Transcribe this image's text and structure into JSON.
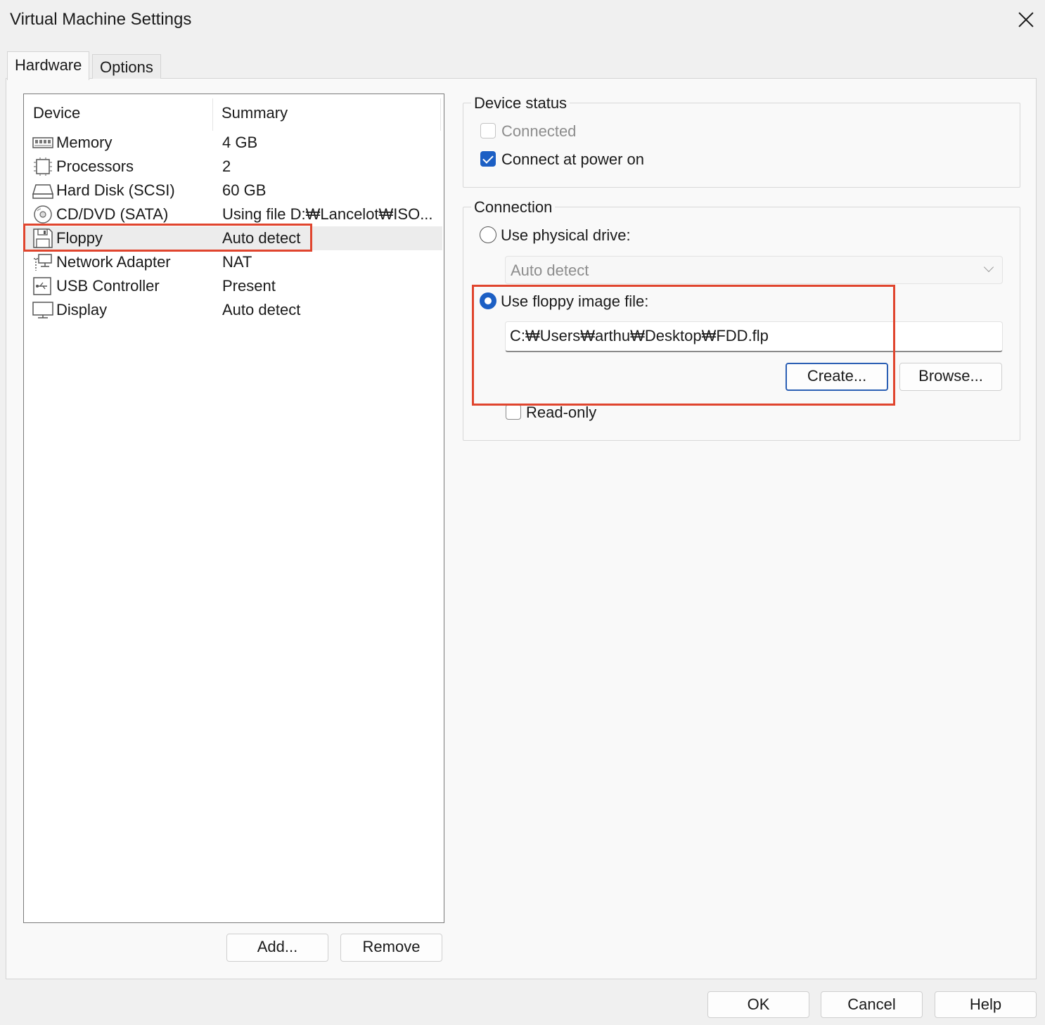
{
  "window": {
    "title": "Virtual Machine Settings"
  },
  "tabs": [
    {
      "label": "Hardware",
      "active": true
    },
    {
      "label": "Options",
      "active": false
    }
  ],
  "device_list": {
    "columns": {
      "device": "Device",
      "summary": "Summary"
    },
    "rows": [
      {
        "icon": "memory-icon",
        "name": "Memory",
        "summary": "4 GB"
      },
      {
        "icon": "processor-icon",
        "name": "Processors",
        "summary": "2"
      },
      {
        "icon": "hard-disk-icon",
        "name": "Hard Disk (SCSI)",
        "summary": "60 GB"
      },
      {
        "icon": "cd-dvd-icon",
        "name": "CD/DVD (SATA)",
        "summary": "Using file D:₩Lancelot₩ISO..."
      },
      {
        "icon": "floppy-icon",
        "name": "Floppy",
        "summary": "Auto detect",
        "selected": true
      },
      {
        "icon": "network-adapter-icon",
        "name": "Network Adapter",
        "summary": "NAT"
      },
      {
        "icon": "usb-icon",
        "name": "USB Controller",
        "summary": "Present"
      },
      {
        "icon": "display-icon",
        "name": "Display",
        "summary": "Auto detect"
      }
    ],
    "add_label": "Add...",
    "remove_label": "Remove"
  },
  "device_status": {
    "label": "Device status",
    "connected": {
      "label": "Connected",
      "checked": false,
      "enabled": false
    },
    "connect_at_power_on": {
      "label": "Connect at power on",
      "checked": true
    }
  },
  "connection": {
    "label": "Connection",
    "use_physical_drive": {
      "label": "Use physical drive:",
      "selected": false
    },
    "physical_drive_value": "Auto detect",
    "use_image_file": {
      "label": "Use floppy image file:",
      "selected": true
    },
    "image_path": "C:₩Users₩arthu₩Desktop₩FDD.flp",
    "create_label": "Create...",
    "browse_label": "Browse...",
    "read_only": {
      "label": "Read-only",
      "checked": false
    }
  },
  "footer": {
    "ok_label": "OK",
    "cancel_label": "Cancel",
    "help_label": "Help"
  },
  "colors": {
    "accent": "#1c5fc4",
    "highlight": "#e0452e"
  }
}
